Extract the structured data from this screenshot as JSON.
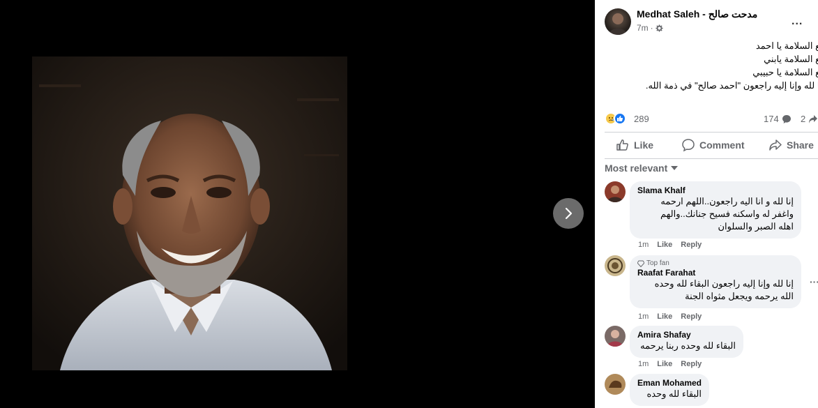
{
  "post": {
    "author": "Medhat Saleh - مدحت صالح",
    "time": "7m",
    "lines": [
      "مع السلامة يا احمد",
      "مع السلامة يابني",
      "مع السلامة يا حبيبي",
      "إنا لله وإنا إليه راجعون \"احمد صالح\" في ذمة الله."
    ],
    "reactions_count": "289",
    "comments_count": "174",
    "shares_count": "2",
    "more_label": "..."
  },
  "actions": {
    "like": "Like",
    "comment": "Comment",
    "share": "Share"
  },
  "sort_label": "Most relevant",
  "comments": [
    {
      "name": "Slama Khalf",
      "lines": [
        "إنا لله و انا اليه راجعون..اللهم ارحمه",
        "واغفر له واسكنه فسيح جنانك..والهم",
        "اهله الصبر والسلوان"
      ],
      "time": "1m",
      "like": "Like",
      "reply": "Reply"
    },
    {
      "badge": "Top fan",
      "name": "Raafat Farahat",
      "lines": [
        "إنا لله وإنا إليه راجعون البقاء لله وحده",
        "الله يرحمه ويجعل مثواه الجنة"
      ],
      "time": "1m",
      "like": "Like",
      "reply": "Reply"
    },
    {
      "name": "Amira Shafay",
      "lines": [
        "البقاء لله وحده ربنا يرحمه"
      ],
      "time": "1m",
      "like": "Like",
      "reply": "Reply"
    },
    {
      "name": "Eman Mohamed",
      "lines": [
        "البقاء لله وحده"
      ]
    }
  ],
  "icons": {
    "next": "chevron-right-icon",
    "privacy": "gear-icon",
    "like": "thumbs-up-icon",
    "comment": "speech-bubble-icon",
    "share": "share-arrow-icon",
    "sort": "caret-down-icon"
  },
  "colors": {
    "accent": "#1877f2",
    "panel_bg": "#ffffff",
    "bubble_bg": "#f0f2f5",
    "viewer_bg": "#000000"
  }
}
